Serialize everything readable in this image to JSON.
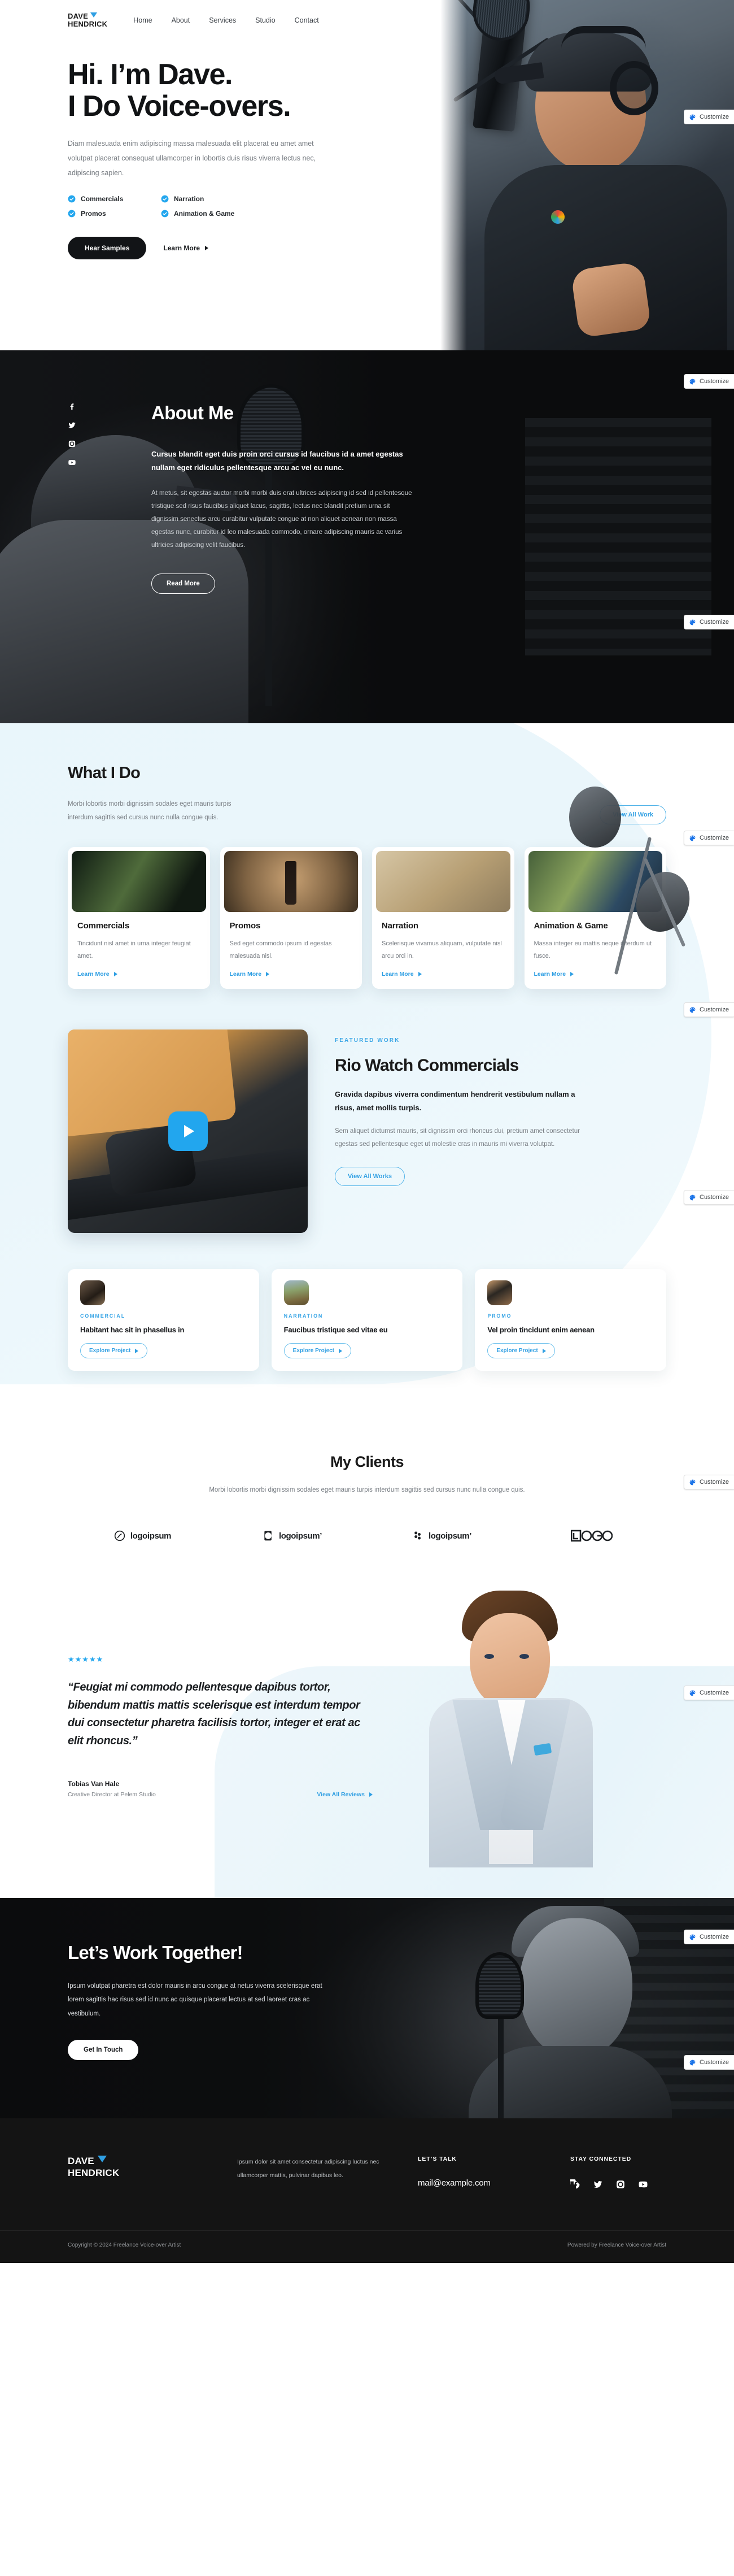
{
  "browser": {
    "customize_label": "Customize",
    "customize_icon": "palette-icon"
  },
  "brand": {
    "line1": "DAVE",
    "line2": "HENDRICK"
  },
  "nav": {
    "items": [
      "Home",
      "About",
      "Services",
      "Studio",
      "Contact"
    ]
  },
  "hero": {
    "title_line1": "Hi. I’m Dave.",
    "title_line2": "I Do Voice-overs.",
    "lead": "Diam malesuada enim adipiscing massa malesuada elit placerat eu amet amet volutpat placerat consequat ullamcorper in lobortis duis risus viverra lectus nec, adipiscing sapien.",
    "features": [
      "Commercials",
      "Narration",
      "Promos",
      "Animation & Game"
    ],
    "primary_btn": "Hear Samples",
    "secondary_btn": "Learn More"
  },
  "about": {
    "heading": "About Me",
    "strong": "Cursus blandit eget duis proin orci cursus id faucibus id a amet egestas nullam eget ridiculus pellentesque arcu ac vel eu nunc.",
    "paragraph": "At metus, sit egestas auctor morbi morbi duis erat ultrices adipiscing id sed id pellentesque tristique sed risus faucibus aliquet lacus, sagittis, lectus nec blandit pretium urna sit dignissim senectus arcu curabitur vulputate congue at non aliquet aenean non massa egestas nunc, curabitur id leo malesuada commodo, ornare adipiscing mauris ac varius ultricies adipiscing velit faucibus.",
    "button": "Read More",
    "socials": [
      "facebook-icon",
      "twitter-icon",
      "instagram-icon",
      "youtube-icon"
    ]
  },
  "services": {
    "heading": "What I Do",
    "sub": "Morbi lobortis morbi dignissim sodales eget mauris turpis interdum sagittis sed cursus nunc nulla congue quis.",
    "cta": "View All Work",
    "learn_more": "Learn More",
    "cards": [
      {
        "title": "Commercials",
        "text": "Tincidunt nisl amet in urna integer feugiat amet.",
        "thumb": "th-comm"
      },
      {
        "title": "Promos",
        "text": "Sed eget commodo ipsum id egestas malesuada nisl.",
        "thumb": "th-promo"
      },
      {
        "title": "Narration",
        "text": "Scelerisque vivamus aliquam, vulputate nisl arcu orci in.",
        "thumb": "th-narr"
      },
      {
        "title": "Animation & Game",
        "text": "Massa integer eu mattis neque interdum ut fusce.",
        "thumb": "th-anim"
      }
    ]
  },
  "featured": {
    "eyebrow": "FEATURED WORK",
    "title": "Rio Watch Commercials",
    "strong": "Gravida dapibus viverra condimentum hendrerit vestibulum nullam a risus, amet mollis turpis.",
    "paragraph": "Sem aliquet dictumst mauris, sit dignissim orci rhoncus dui, pretium amet consectetur egestas sed pellentesque eget ut molestie cras in mauris mi viverra volutpat.",
    "button": "View All Works",
    "play_icon": "play-icon"
  },
  "projects": {
    "explore_label": "Explore Project",
    "items": [
      {
        "tag": "COMMERCIAL",
        "title": "Habitant hac sit in phasellus in",
        "icon": "pi-commercial"
      },
      {
        "tag": "NARRATION",
        "title": "Faucibus tristique sed vitae eu",
        "icon": "pi-narration"
      },
      {
        "tag": "PROMO",
        "title": "Vel proin tincidunt enim aenean",
        "icon": "pi-promo"
      }
    ]
  },
  "clients": {
    "heading": "My Clients",
    "sub": "Morbi lobortis morbi dignissim sodales eget mauris turpis interdum sagittis sed cursus nunc nulla congue quis.",
    "logos": [
      "logoipsum",
      "logoipsum’",
      "logoipsum’",
      "LOGO"
    ]
  },
  "testimonial": {
    "stars": "★★★★★",
    "quote": "“Feugiat mi commodo pellentesque dapibus tortor, bibendum mattis mattis scelerisque est interdum tempor dui consectetur pharetra facilisis tortor, integer et erat ac elit rhoncus.”",
    "author": "Tobias Van Hale",
    "role": "Creative Director at Pelem Studio",
    "link": "View All Reviews"
  },
  "cta": {
    "heading": "Let’s Work Together!",
    "paragraph": "Ipsum volutpat pharetra est dolor mauris in arcu congue at netus viverra scelerisque erat lorem sagittis hac risus sed id nunc ac quisque placerat lectus at sed laoreet cras ac vestibulum.",
    "button": "Get In Touch"
  },
  "footer": {
    "desc": "Ipsum dolor sit amet consectetur adipiscing luctus nec ullamcorper mattis, pulvinar dapibus leo.",
    "talk_head": "LET’S TALK",
    "email": "mail@example.com",
    "connected_head": "STAY CONNECTED",
    "socials": [
      "facebook-icon",
      "twitter-icon",
      "instagram-icon",
      "youtube-icon"
    ],
    "copyright": "Copyright © 2024 Freelance Voice-over Artist",
    "powered": "Powered by Freelance Voice-over Artist"
  },
  "colors": {
    "accent": "#2f9fe3",
    "dark": "#121417",
    "light_blue_bg": "#eaf6fb"
  }
}
